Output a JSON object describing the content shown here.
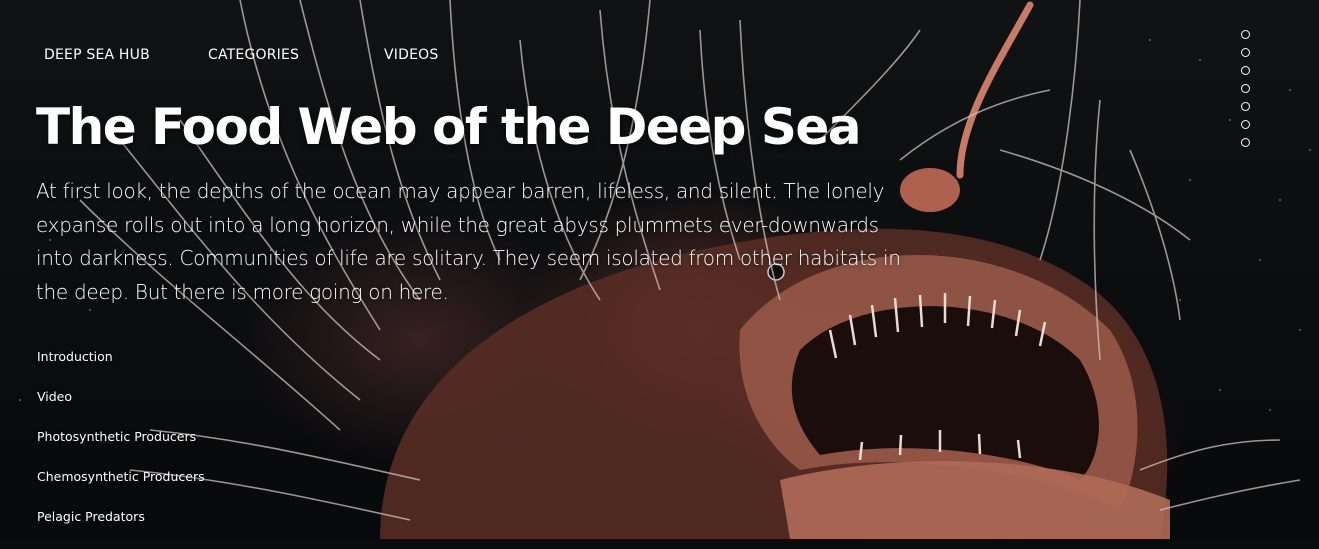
{
  "nav": {
    "home": "DEEP SEA HUB",
    "categories": "CATEGORIES",
    "videos": "VIDEOS"
  },
  "hero": {
    "title": "The Food Web of the Deep Sea",
    "intro": "At first look, the depths of the ocean may appear barren, lifeless, and silent. The lonely expanse rolls out into a long horizon, while the great abyss plummets ever-downwards into darkness. Communities of life are solitary. They seem isolated from other habitats in the deep. But there is more going on here.",
    "image_subject": "anglerfish"
  },
  "toc": {
    "items": [
      {
        "label": "Introduction"
      },
      {
        "label": "Video"
      },
      {
        "label": "Photosynthetic Producers"
      },
      {
        "label": "Chemosynthetic Producers"
      },
      {
        "label": "Pelagic Predators"
      }
    ]
  },
  "section_dots": {
    "count": 7
  },
  "colors": {
    "text": "#ffffff",
    "background": "#0a0b0d",
    "fish": "#8a4a3c"
  }
}
